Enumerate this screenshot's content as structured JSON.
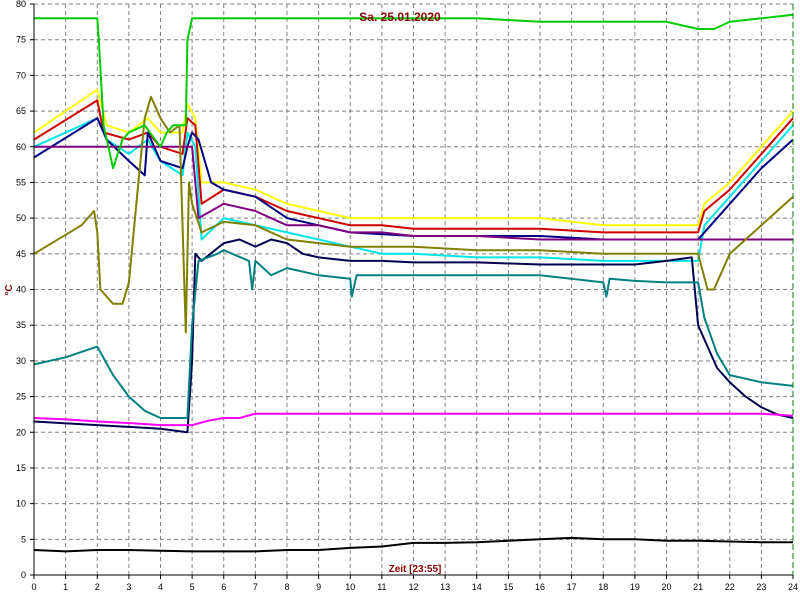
{
  "chart_data": {
    "type": "line",
    "title": "Sa. 25.01.2020",
    "xlabel": "Zeit [23:55]",
    "ylabel": "°C",
    "xlim": [
      0,
      24
    ],
    "ylim": [
      0,
      80
    ],
    "x_ticks": [
      "0",
      "1",
      "2",
      "3",
      "4",
      "5",
      "6",
      "7",
      "8",
      "9",
      "10",
      "11",
      "12",
      "13",
      "14",
      "15",
      "16",
      "17",
      "18",
      "19",
      "20",
      "21",
      "22",
      "23",
      "24"
    ],
    "y_ticks": [
      "0",
      "5",
      "10",
      "15",
      "20",
      "25",
      "30",
      "35",
      "40",
      "45",
      "50",
      "55",
      "60",
      "65",
      "70",
      "75",
      "80"
    ],
    "grid": true,
    "colors": {
      "title": "#8b0000",
      "axis_labels": "#8b0000",
      "grid": "#808080",
      "end_marker": "#008000"
    },
    "series": [
      {
        "color": "#ffff00",
        "x": [
          0,
          2,
          2.3,
          3,
          3.6,
          4,
          4.7,
          4.85,
          5.1,
          5.3,
          6,
          7,
          8,
          9,
          10,
          11,
          12,
          14,
          16,
          18,
          19,
          20,
          21,
          21.2,
          22,
          23,
          24
        ],
        "y": [
          62,
          68,
          63,
          62,
          64,
          62,
          62,
          66,
          64,
          55,
          55,
          54,
          52,
          51,
          50,
          50,
          50,
          50,
          50,
          49,
          49,
          49,
          49,
          52,
          55,
          60,
          65
        ]
      },
      {
        "color": "#cc0000",
        "x": [
          0,
          2,
          2.2,
          3,
          3.6,
          4,
          4.7,
          4.85,
          5.1,
          5.3,
          6,
          7,
          8,
          9,
          10,
          11,
          12,
          14,
          16,
          18,
          19,
          20,
          21,
          21.2,
          22,
          23,
          24
        ],
        "y": [
          61,
          66.5,
          62,
          61,
          62,
          60,
          59,
          64,
          63,
          52,
          54,
          53,
          51,
          50,
          49,
          49,
          48.5,
          48.5,
          48.5,
          48,
          48,
          48,
          48,
          51,
          54,
          59,
          64
        ]
      },
      {
        "color": "#00e5e5",
        "x": [
          0,
          2,
          2.3,
          3,
          3.6,
          4,
          4.7,
          4.85,
          5.1,
          5.3,
          6,
          7,
          8,
          9,
          10,
          11,
          12,
          14,
          16,
          18,
          19,
          20,
          21,
          21.2,
          22,
          23,
          24
        ],
        "y": [
          60,
          64,
          61,
          59,
          61,
          58,
          56,
          62,
          60,
          47,
          50,
          49,
          48,
          47,
          46,
          45,
          45,
          44.5,
          44.5,
          44,
          44,
          44,
          44,
          49,
          53,
          58,
          63
        ]
      },
      {
        "color": "#000080",
        "x": [
          0,
          2,
          2.3,
          3,
          3.5,
          3.6,
          3.8,
          4,
          4.7,
          4.85,
          5,
          5.2,
          5.6,
          6,
          7,
          8,
          9,
          10,
          12,
          14,
          16,
          18,
          20,
          21,
          21.2,
          22,
          23,
          24
        ],
        "y": [
          58.5,
          64,
          61,
          58,
          56,
          62,
          60,
          58,
          57,
          60,
          62,
          61,
          55,
          54,
          53,
          50,
          49,
          48,
          47.5,
          47.5,
          47.5,
          47,
          47,
          47,
          48,
          52,
          57,
          61
        ]
      },
      {
        "color": "#800080",
        "x": [
          0,
          5,
          5.2,
          6,
          7,
          8,
          9,
          10,
          11,
          12,
          14,
          16,
          18,
          20,
          21,
          22,
          24
        ],
        "y": [
          60,
          60,
          50,
          52,
          51,
          49,
          49,
          48,
          48,
          47.5,
          47.5,
          47,
          47,
          47,
          47,
          47,
          47
        ]
      },
      {
        "color": "#808000",
        "x": [
          0,
          1.5,
          1.9,
          2,
          2.1,
          2.5,
          2.8,
          3,
          3.3,
          3.5,
          3.7,
          4,
          4.3,
          4.6,
          4.8,
          4.9,
          5,
          5.3,
          6,
          7,
          8,
          10,
          12,
          14,
          16,
          18,
          20,
          21,
          21.3,
          21.5,
          22,
          23,
          24
        ],
        "y": [
          45,
          49,
          51,
          48,
          40,
          38,
          38,
          41,
          55,
          64,
          67,
          64,
          62,
          63,
          34,
          55,
          52,
          48,
          49.5,
          49,
          47,
          46,
          46,
          45.5,
          45.5,
          45,
          45,
          45,
          40,
          40,
          45,
          49,
          53
        ]
      },
      {
        "color": "#00cc00",
        "x": [
          0,
          2,
          2.05,
          2.2,
          2.5,
          2.8,
          3,
          3.5,
          4,
          4.2,
          4.4,
          4.6,
          4.8,
          4.85,
          5,
          6,
          8,
          10,
          12,
          14,
          16,
          18,
          20,
          21,
          21.5,
          22,
          23,
          24
        ],
        "y": [
          78,
          78,
          75,
          63,
          57,
          61,
          62,
          63,
          60,
          62,
          63,
          63,
          63,
          75,
          78,
          78,
          78,
          78,
          78,
          78,
          77.5,
          77.5,
          77.5,
          76.5,
          76.5,
          77.5,
          78,
          78.5
        ]
      },
      {
        "color": "#000050",
        "x": [
          0,
          4,
          4.85,
          5,
          5.1,
          5.3,
          6,
          6.5,
          7,
          7.5,
          8,
          8.5,
          9,
          10,
          11,
          12,
          14,
          16,
          18,
          19,
          20,
          20.8,
          21,
          21.2,
          21.6,
          22,
          22.5,
          23,
          23.5,
          24
        ],
        "y": [
          21.5,
          20.5,
          20,
          30,
          45,
          44,
          46.5,
          47,
          46,
          47,
          46.5,
          45,
          44.5,
          44,
          44,
          43.8,
          43.8,
          43.5,
          43.5,
          43.5,
          44,
          44.5,
          35,
          33,
          29,
          27,
          25,
          23.5,
          22.5,
          22
        ]
      },
      {
        "color": "#008080",
        "x": [
          0,
          1,
          2,
          2.5,
          3,
          3.5,
          4,
          4.85,
          5,
          5.2,
          5.8,
          6,
          6.8,
          6.9,
          7,
          7.5,
          8,
          9,
          10,
          10.05,
          10.2,
          11,
          12,
          14,
          16,
          18,
          18.1,
          18.2,
          19,
          20,
          21,
          21.2,
          21.6,
          22,
          23,
          24
        ],
        "y": [
          29.5,
          30.5,
          32,
          28,
          25,
          23,
          22,
          22,
          35,
          44,
          45,
          45.5,
          44,
          40,
          44,
          42,
          43,
          42,
          41.5,
          39,
          42,
          42,
          42,
          42,
          42,
          41,
          39,
          41.5,
          41.2,
          41,
          41,
          36,
          31,
          28,
          27,
          26.5
        ]
      },
      {
        "color": "#ff00ff",
        "x": [
          0,
          1,
          2,
          3,
          4,
          5,
          5.5,
          6,
          6.5,
          7,
          8,
          10,
          12,
          14,
          16,
          18,
          20,
          21,
          22,
          23,
          24
        ],
        "y": [
          22,
          21.8,
          21.5,
          21.3,
          21,
          21,
          21.6,
          22,
          22,
          22.6,
          22.6,
          22.6,
          22.6,
          22.6,
          22.6,
          22.6,
          22.6,
          22.6,
          22.6,
          22.6,
          22.3
        ]
      },
      {
        "color": "#000000",
        "x": [
          0,
          1,
          2,
          3,
          4,
          5,
          6,
          7,
          8,
          9,
          10,
          11,
          12,
          13,
          14,
          15,
          16,
          17,
          18,
          19,
          20,
          21,
          22,
          23,
          24
        ],
        "y": [
          3.5,
          3.3,
          3.5,
          3.5,
          3.4,
          3.3,
          3.3,
          3.3,
          3.5,
          3.5,
          3.8,
          4,
          4.5,
          4.5,
          4.6,
          4.8,
          5,
          5.2,
          5,
          5,
          4.8,
          4.8,
          4.7,
          4.6,
          4.6
        ]
      }
    ]
  }
}
